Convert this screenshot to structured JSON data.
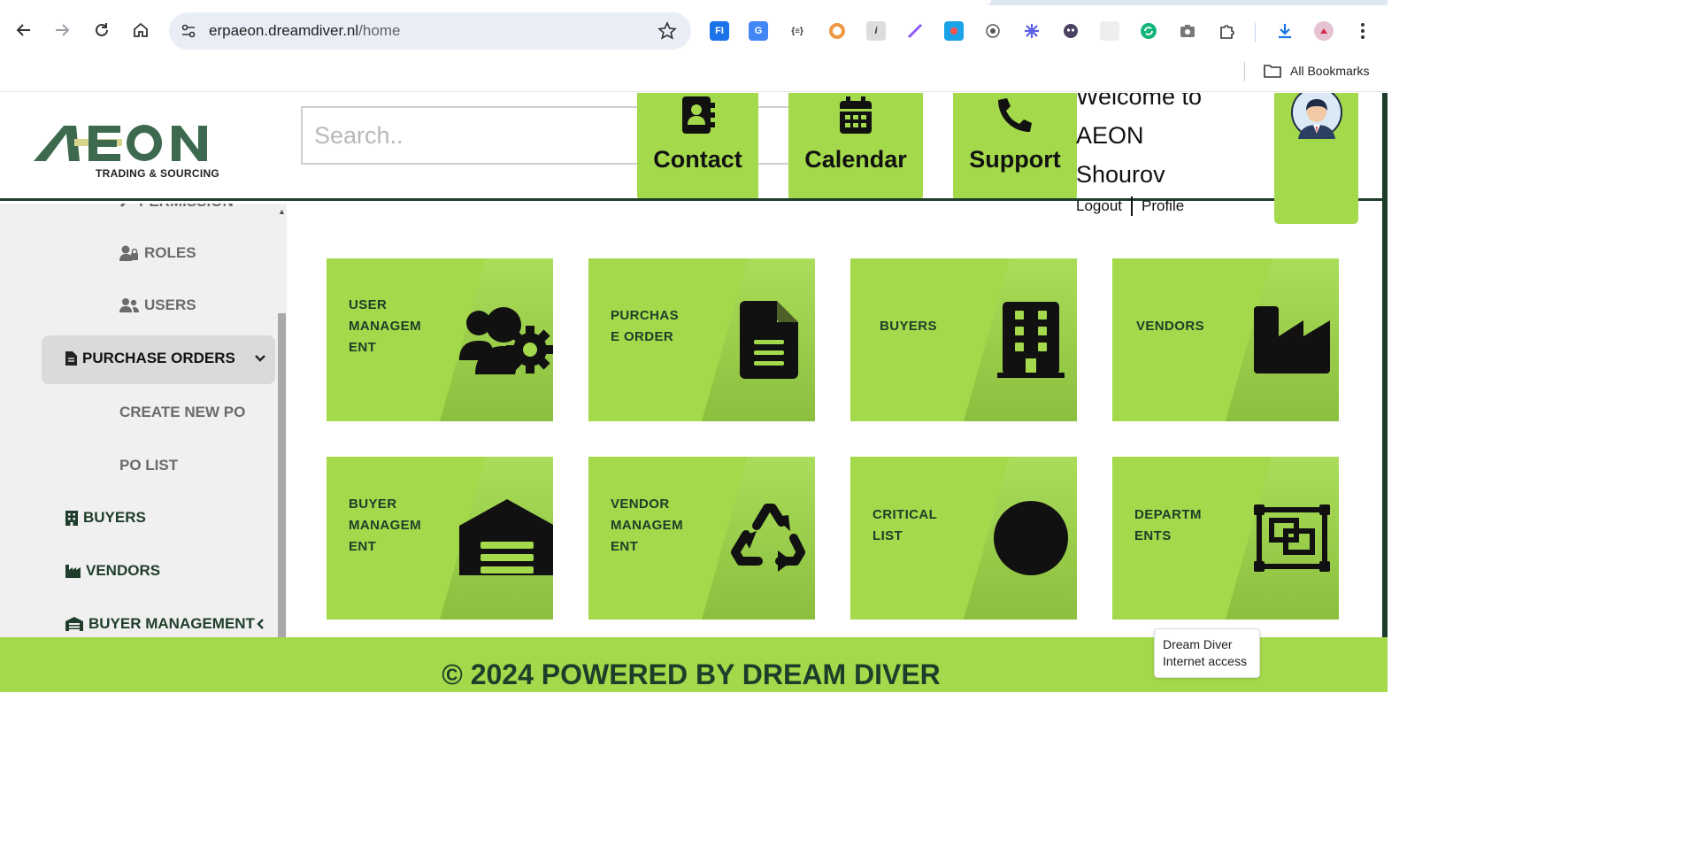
{
  "browser": {
    "url_host": "erpaeon.dreamdiver.nl",
    "url_path": "/home",
    "bookmarks_label": "All Bookmarks"
  },
  "header": {
    "logo_text": "AEON",
    "logo_tagline": "TRADING & SOURCING",
    "search_placeholder": "Search..",
    "quick_buttons": {
      "contact": "Contact",
      "calendar": "Calendar",
      "support": "Support"
    },
    "welcome_line1": "Welcome to",
    "welcome_line2": "AEON",
    "welcome_name": "Shourov",
    "logout": "Logout",
    "profile": "Profile"
  },
  "sidebar": {
    "permission_partial": "PERMISSION",
    "roles": "ROLES",
    "users": "USERS",
    "purchase_orders": "PURCHASE ORDERS",
    "create_new_po": "CREATE NEW PO",
    "po_list": "PO LIST",
    "buyers": "BUYERS",
    "vendors": "VENDORS",
    "buyer_management": "BUYER MANAGEMENT"
  },
  "cards": {
    "user_management": [
      "USER",
      "MANAGEM",
      "ENT"
    ],
    "purchase_order": [
      "PURCHAS",
      "E ORDER"
    ],
    "buyers": [
      "BUYERS"
    ],
    "vendors": [
      "VENDORS"
    ],
    "buyer_management": [
      "BUYER",
      "MANAGEM",
      "ENT"
    ],
    "vendor_management": [
      "VENDOR",
      "MANAGEM",
      "ENT"
    ],
    "critical_list": [
      "CRITICAL",
      "LIST"
    ],
    "departments": [
      "DEPARTM",
      "ENTS"
    ]
  },
  "footer": {
    "text": "© 2024 POWERED BY DREAM DIVER"
  },
  "tooltip": {
    "line1": "Dream Diver",
    "line2": "Internet access"
  },
  "colors": {
    "brand_green": "#a3d94a",
    "dark_green": "#1e3d2a"
  }
}
